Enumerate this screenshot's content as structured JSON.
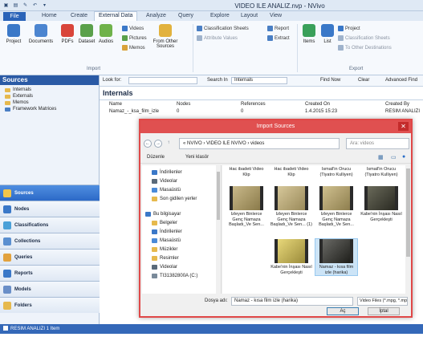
{
  "window": {
    "title": "VIDEO ILE ANALIZ.nvp - NVivo"
  },
  "ribbon_tabs": [
    {
      "label": "File"
    },
    {
      "label": "Home"
    },
    {
      "label": "Create"
    },
    {
      "label": "External Data"
    },
    {
      "label": "Analyze"
    },
    {
      "label": "Query"
    },
    {
      "label": "Explore"
    },
    {
      "label": "Layout"
    },
    {
      "label": "View"
    }
  ],
  "ribbon": {
    "project": "Project",
    "documents": "Documents",
    "pdfs": "PDFs",
    "dataset": "Dataset",
    "audios": "Audios",
    "videos": "Videos",
    "pictures": "Pictures",
    "memos": "Memos",
    "from_other_sources": "From Other Sources",
    "classification_sheets": "Classification Sheets",
    "attribute_values": "Attribute Values",
    "report": "Report",
    "extract": "Extract",
    "items": "Items",
    "list": "List",
    "export_project": "Project",
    "export_class_sheets": "Classification Sheets",
    "to_other_destinations": "To Other Destinations",
    "group_import": "Import",
    "group_export": "Export"
  },
  "sidebar": {
    "title": "Sources",
    "tree": [
      {
        "label": "Internals"
      },
      {
        "label": "Externals"
      },
      {
        "label": "Memos"
      },
      {
        "label": "Framework Matrices"
      }
    ],
    "nav": [
      {
        "label": "Sources"
      },
      {
        "label": "Nodes"
      },
      {
        "label": "Classifications"
      },
      {
        "label": "Collections"
      },
      {
        "label": "Queries"
      },
      {
        "label": "Reports"
      },
      {
        "label": "Models"
      },
      {
        "label": "Folders"
      }
    ]
  },
  "lookbar": {
    "look_for": "Look for:",
    "search_in": "Search In",
    "scope": "Internals",
    "find_now": "Find Now",
    "clear": "Clear",
    "advanced_find": "Advanced Find"
  },
  "content": {
    "title": "Internals",
    "columns": {
      "name": "Name",
      "nodes": "Nodes",
      "references": "References",
      "created_on": "Created On",
      "created_by": "Created By"
    },
    "row": {
      "name": "Namaz_-_ksa_film_izle",
      "nodes": "0",
      "references": "0",
      "created_on": "1.4.2015 15:23",
      "created_by": "RESIM ANALIZI"
    }
  },
  "status": {
    "text": "RESIM ANALIZI  1 Item"
  },
  "dialog": {
    "title": "Import Sources",
    "path": "«  NVIVO  ›  VIDEO ILE NVIVO  ›  videos",
    "search_placeholder": "Ara: videos",
    "organize": "Düzenle",
    "new_folder": "Yeni klasör",
    "nav_items": [
      {
        "label": "İndirilenler"
      },
      {
        "label": "Videolar"
      },
      {
        "label": "Masaüstü"
      },
      {
        "label": "Son gidilen yerler"
      },
      {
        "label": "Bu bilgisayar"
      },
      {
        "label": "Belgeler"
      },
      {
        "label": "İndirilenler"
      },
      {
        "label": "Masaüstü"
      },
      {
        "label": "Müzikler"
      },
      {
        "label": "Resimler"
      },
      {
        "label": "Videolar"
      },
      {
        "label": "TI31382800A (C:)"
      }
    ],
    "files": [
      {
        "name": "Hac ibadeti Video Klip"
      },
      {
        "name": "Hac ibadeti Video Klip"
      },
      {
        "name": "Ismail'in Orucu (Tiyatro Kulliyen)"
      },
      {
        "name": "Ismail'in Orucu (Tiyatro Kulliyen)"
      },
      {
        "name": "Izleyen Binlerce Genç Namaza Başladı_Ve Sen..."
      },
      {
        "name": "Izleyen Binlerce Genç Namaza Başladı_Ve Sen... (1)"
      },
      {
        "name": "Izleyen Binlerce Genç Namaza Başladı_Ve Sen..."
      },
      {
        "name": "Kabe'nin İnşası Nasıl Gerçekleşti"
      },
      {
        "name": "Kabe'nin İnşası Nasıl Gerçekleşti"
      },
      {
        "name": "Namaz - kısa film izle (harika)"
      }
    ],
    "filename_label": "Dosya adı:",
    "filename": "Namaz - kısa film izle (harika)",
    "filetype": "Video Files (*.mpg, *.mpeg, *.m",
    "open": "Aç",
    "cancel": "İptal"
  }
}
